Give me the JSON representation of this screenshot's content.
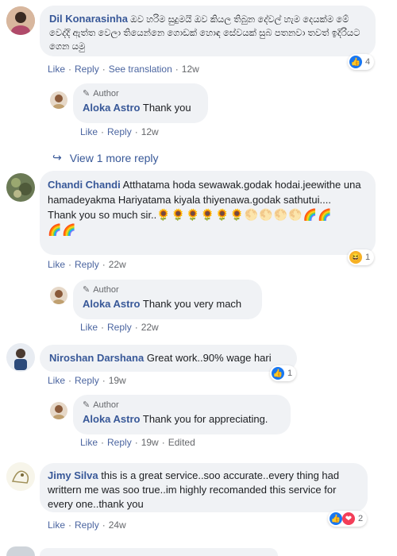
{
  "comments": [
    {
      "name": "Dil Konarasinha",
      "text": "ඔව හරිම සුදුමයි ඔව කියල තිබුන දේවල් හැම දෙයක්ම මේ වෙද්දි ඇත්ත වෙලා තියෙන්නෙ ගොඩක් හොඳ සේවයක් සුබ පතනවා තවත් ඉදිරියට ගෙන යමු",
      "actions": {
        "like": "Like",
        "reply": "Reply",
        "translate": "See translation",
        "time": "12w"
      },
      "reactions": {
        "count": "4"
      }
    },
    {
      "name": "Chandi Chandi",
      "text": "Atthatama hoda sewawak.godak hodai.jeewithe una hamadeyakma Hariyatama kiyala thiyenawa.godak sathutui....",
      "text2": "Thank you so much sir..",
      "emojis": "🌻🌻🌻🌻🌻🌻🌕🌕🌕🌕🌈🌈",
      "emojis2": "🌈🌈",
      "actions": {
        "like": "Like",
        "reply": "Reply",
        "time": "22w"
      },
      "reactions": {
        "count": "1"
      }
    },
    {
      "name": "Niroshan Darshana",
      "text": "Great work..90% wage hari",
      "actions": {
        "like": "Like",
        "reply": "Reply",
        "time": "19w"
      },
      "reactions": {
        "count": "1"
      }
    },
    {
      "name": "Jimy Silva",
      "text": "this is a great service..soo accurate..every thing had writtern me was soo true..im highly recomanded this service for every one..thank you",
      "actions": {
        "like": "Like",
        "reply": "Reply",
        "time": "24w"
      },
      "reactions": {
        "count": "2"
      }
    }
  ],
  "replies": [
    {
      "author_tag": "Author",
      "name": "Aloka Astro",
      "text": "Thank you",
      "actions": {
        "like": "Like",
        "reply": "Reply",
        "time": "12w"
      }
    },
    {
      "author_tag": "Author",
      "name": "Aloka Astro",
      "text": "Thank you very mach",
      "actions": {
        "like": "Like",
        "reply": "Reply",
        "time": "22w"
      }
    },
    {
      "author_tag": "Author",
      "name": "Aloka Astro",
      "text": "Thank you for appreciating.",
      "actions": {
        "like": "Like",
        "reply": "Reply",
        "time": "19w",
        "edited": "Edited"
      }
    }
  ],
  "view_more": "View 1 more reply",
  "separator": "·",
  "colors": {
    "name": "#385898",
    "bubble": "#f0f2f5",
    "like": "#1877f2",
    "love": "#f33e58"
  }
}
